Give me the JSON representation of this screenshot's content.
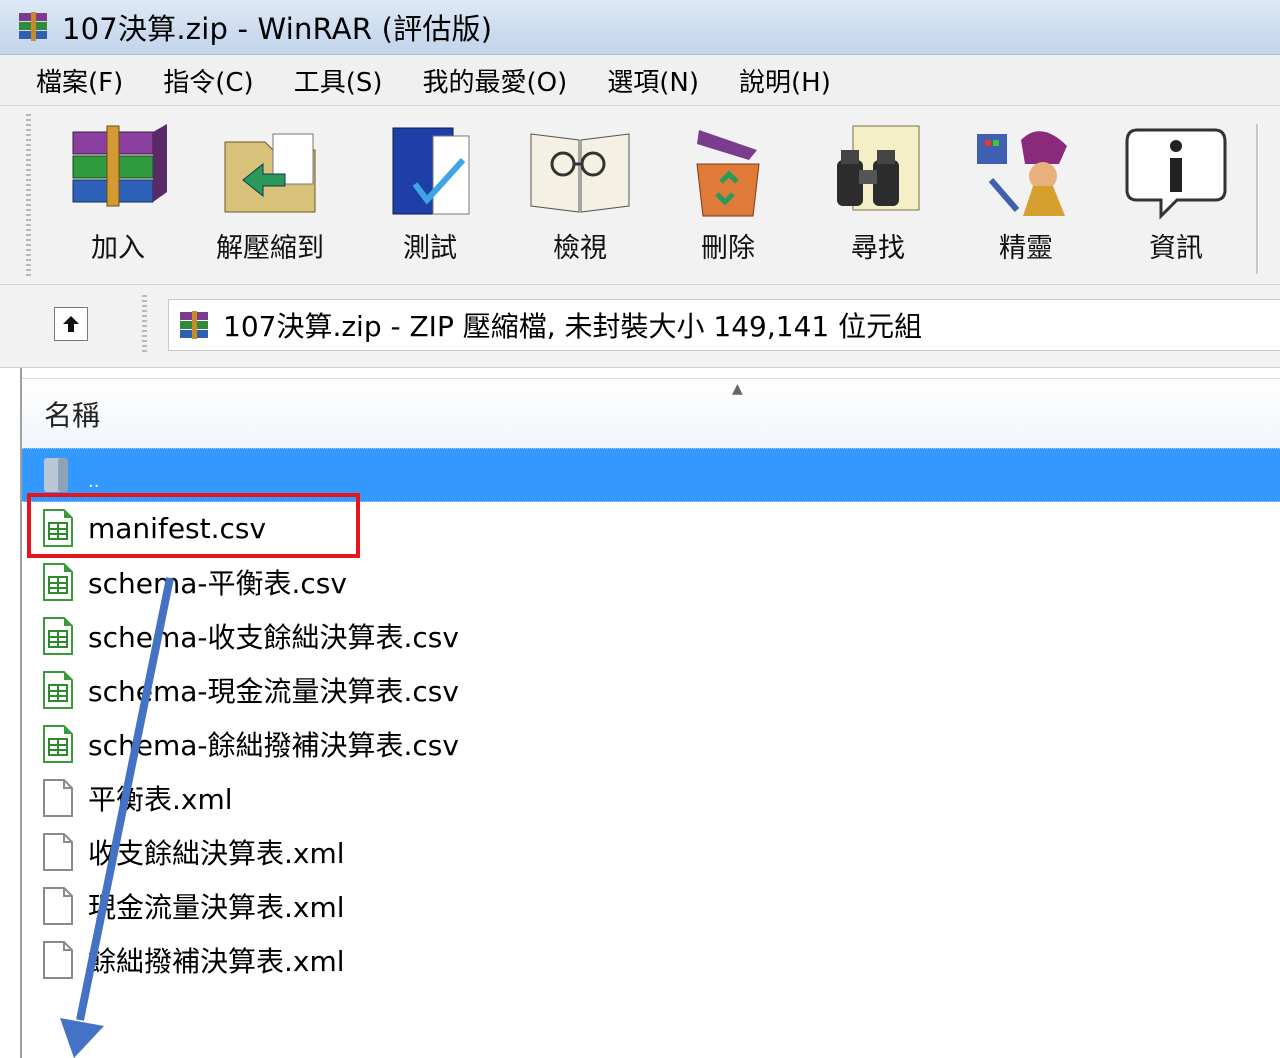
{
  "window": {
    "title": "107決算.zip - WinRAR (評估版)"
  },
  "menu": [
    "檔案(F)",
    "指令(C)",
    "工具(S)",
    "我的最愛(O)",
    "選項(N)",
    "說明(H)"
  ],
  "toolbar": {
    "add": "加入",
    "extract_to": "解壓縮到",
    "test": "測試",
    "view": "檢視",
    "delete": "刪除",
    "find": "尋找",
    "wizard": "精靈",
    "info": "資訊"
  },
  "address": {
    "path_text": "107決算.zip - ZIP 壓縮檔, 未封裝大小 149,141 位元組"
  },
  "list": {
    "column_name": "名稱",
    "parent": "..",
    "files": [
      {
        "name": "manifest.csv",
        "type": "csv"
      },
      {
        "name": "schema-平衡表.csv",
        "type": "csv"
      },
      {
        "name": "schema-收支餘絀決算表.csv",
        "type": "csv"
      },
      {
        "name": "schema-現金流量決算表.csv",
        "type": "csv"
      },
      {
        "name": "schema-餘絀撥補決算表.csv",
        "type": "csv"
      },
      {
        "name": "平衡表.xml",
        "type": "xml"
      },
      {
        "name": "收支餘絀決算表.xml",
        "type": "xml"
      },
      {
        "name": "現金流量決算表.xml",
        "type": "xml"
      },
      {
        "name": "餘絀撥補決算表.xml",
        "type": "xml"
      }
    ]
  },
  "colors": {
    "selection": "#3399ff",
    "highlight_box": "#e8141c",
    "annotation_arrow": "#4472c4"
  }
}
